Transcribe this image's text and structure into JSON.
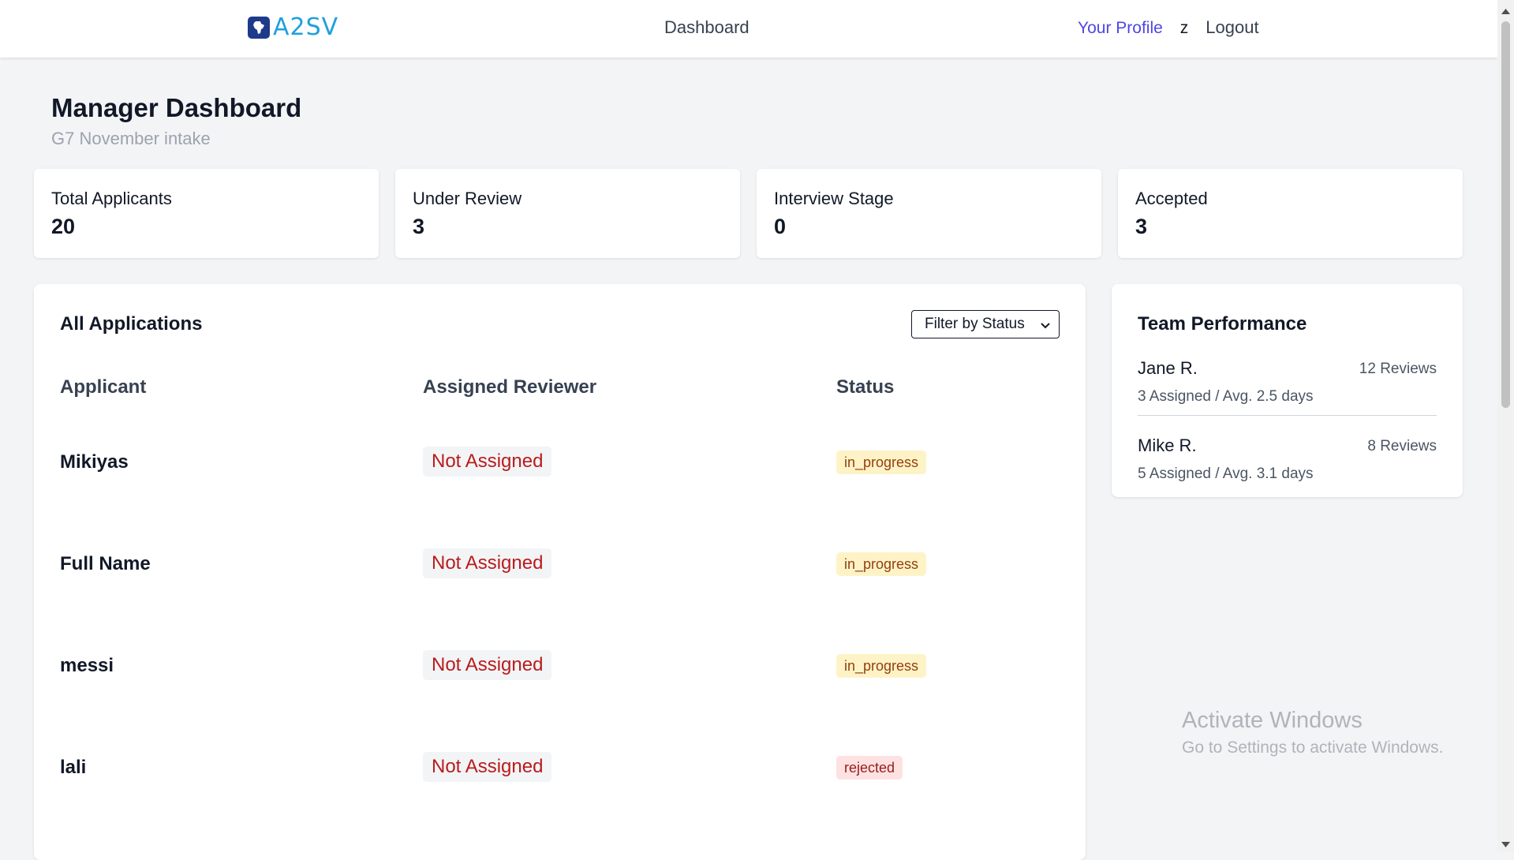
{
  "header": {
    "logo_text": "A2SV",
    "nav_center": "Dashboard",
    "profile_link": "Your Profile",
    "user_initial": "z",
    "logout": "Logout"
  },
  "page": {
    "title": "Manager Dashboard",
    "subtitle": "G7 November intake"
  },
  "stats": [
    {
      "label": "Total Applicants",
      "value": "20"
    },
    {
      "label": "Under Review",
      "value": "3"
    },
    {
      "label": "Interview Stage",
      "value": "0"
    },
    {
      "label": "Accepted",
      "value": "3"
    }
  ],
  "applications": {
    "title": "All Applications",
    "filter": {
      "selected": "Filter by Status"
    },
    "columns": [
      "Applicant",
      "Assigned Reviewer",
      "Status"
    ],
    "rows": [
      {
        "name": "Mikiyas",
        "reviewer": "Not Assigned",
        "status": "in_progress"
      },
      {
        "name": "Full Name",
        "reviewer": "Not Assigned",
        "status": "in_progress"
      },
      {
        "name": "messi",
        "reviewer": "Not Assigned",
        "status": "in_progress"
      },
      {
        "name": "lali",
        "reviewer": "Not Assigned",
        "status": "rejected"
      }
    ]
  },
  "team": {
    "title": "Team Performance",
    "members": [
      {
        "name": "Jane R.",
        "reviews": "12 Reviews",
        "meta": "3 Assigned / Avg. 2.5 days"
      },
      {
        "name": "Mike R.",
        "reviews": "8 Reviews",
        "meta": "5 Assigned / Avg. 3.1 days"
      }
    ]
  },
  "watermark": {
    "title": "Activate Windows",
    "subtitle": "Go to Settings to activate Windows."
  },
  "icons": {
    "logo": "africa-map-icon",
    "filter": "chevron-down-icon",
    "scroll_up": "scroll-up-arrow-icon",
    "scroll_down": "scroll-down-arrow-icon"
  },
  "colors": {
    "accent_link": "#4f46e5",
    "logo_blue": "#1ea0dc",
    "logo_mark": "#1e3a8a",
    "not_assigned_text": "#b91c1c",
    "in_progress_bg": "#fef3c7",
    "rejected_bg": "#fee2e2"
  }
}
